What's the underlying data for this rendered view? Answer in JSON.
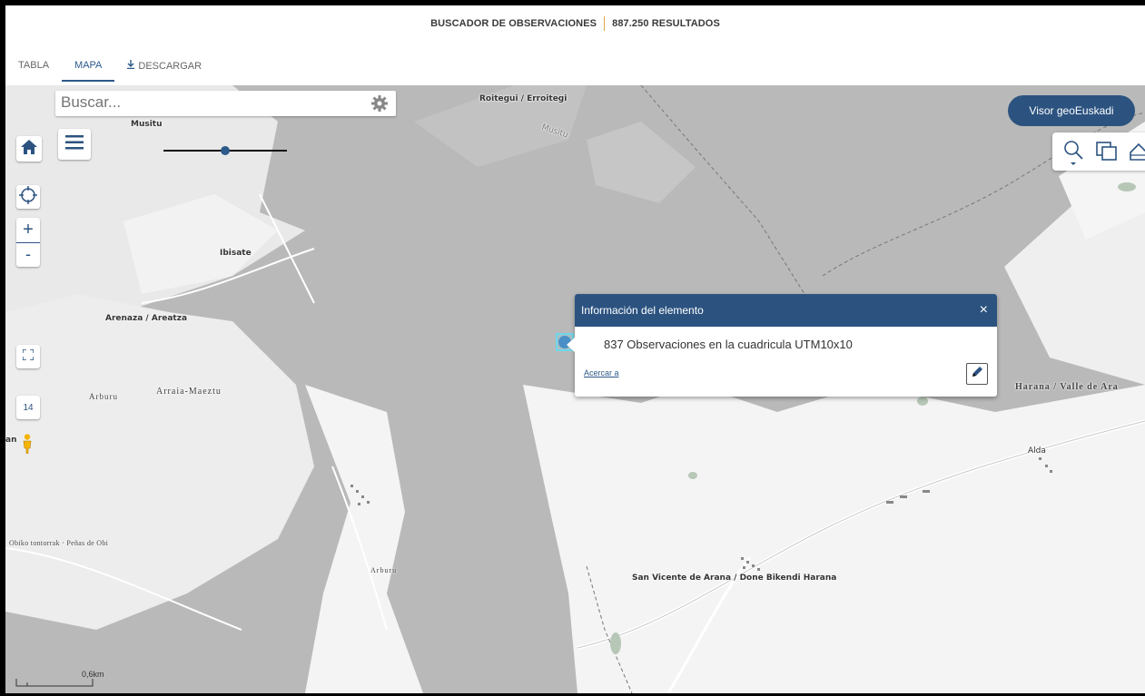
{
  "header": {
    "title": "BUSCADOR DE OBSERVACIONES",
    "results": "887.250 RESULTADOS"
  },
  "tabs": [
    {
      "label": "TABLA"
    },
    {
      "label": "MAPA",
      "active": true
    },
    {
      "label": "DESCARGAR",
      "icon": "download-icon"
    }
  ],
  "map": {
    "search_placeholder": "Buscar...",
    "zoom_level": "14",
    "scale_label": "0,6km",
    "geo_button": "Visor geoEuskadi",
    "zoom_in": "+",
    "zoom_out": "-",
    "labels": [
      "Musitu",
      "Roitegui / Erroitegi",
      "Musitu",
      "Ibisate",
      "Arenaza / Areatza",
      "Arburu",
      "Arraia-Maeztu",
      "an",
      "Harana / Valle de Ara",
      "Alda",
      "Obiko tontorrak · Peñas de Obi",
      "Arburu",
      "San Vicente de Arana / Done Bikendi Harana"
    ]
  },
  "popup": {
    "title": "Información del elemento",
    "close": "×",
    "text": "837 Observaciones en la cuadricula UTM10x10",
    "link": "Acercar a"
  },
  "colors": {
    "accent": "#2c5380",
    "map_dark": "#b9b9b9",
    "map_light": "#f3f3f3"
  }
}
